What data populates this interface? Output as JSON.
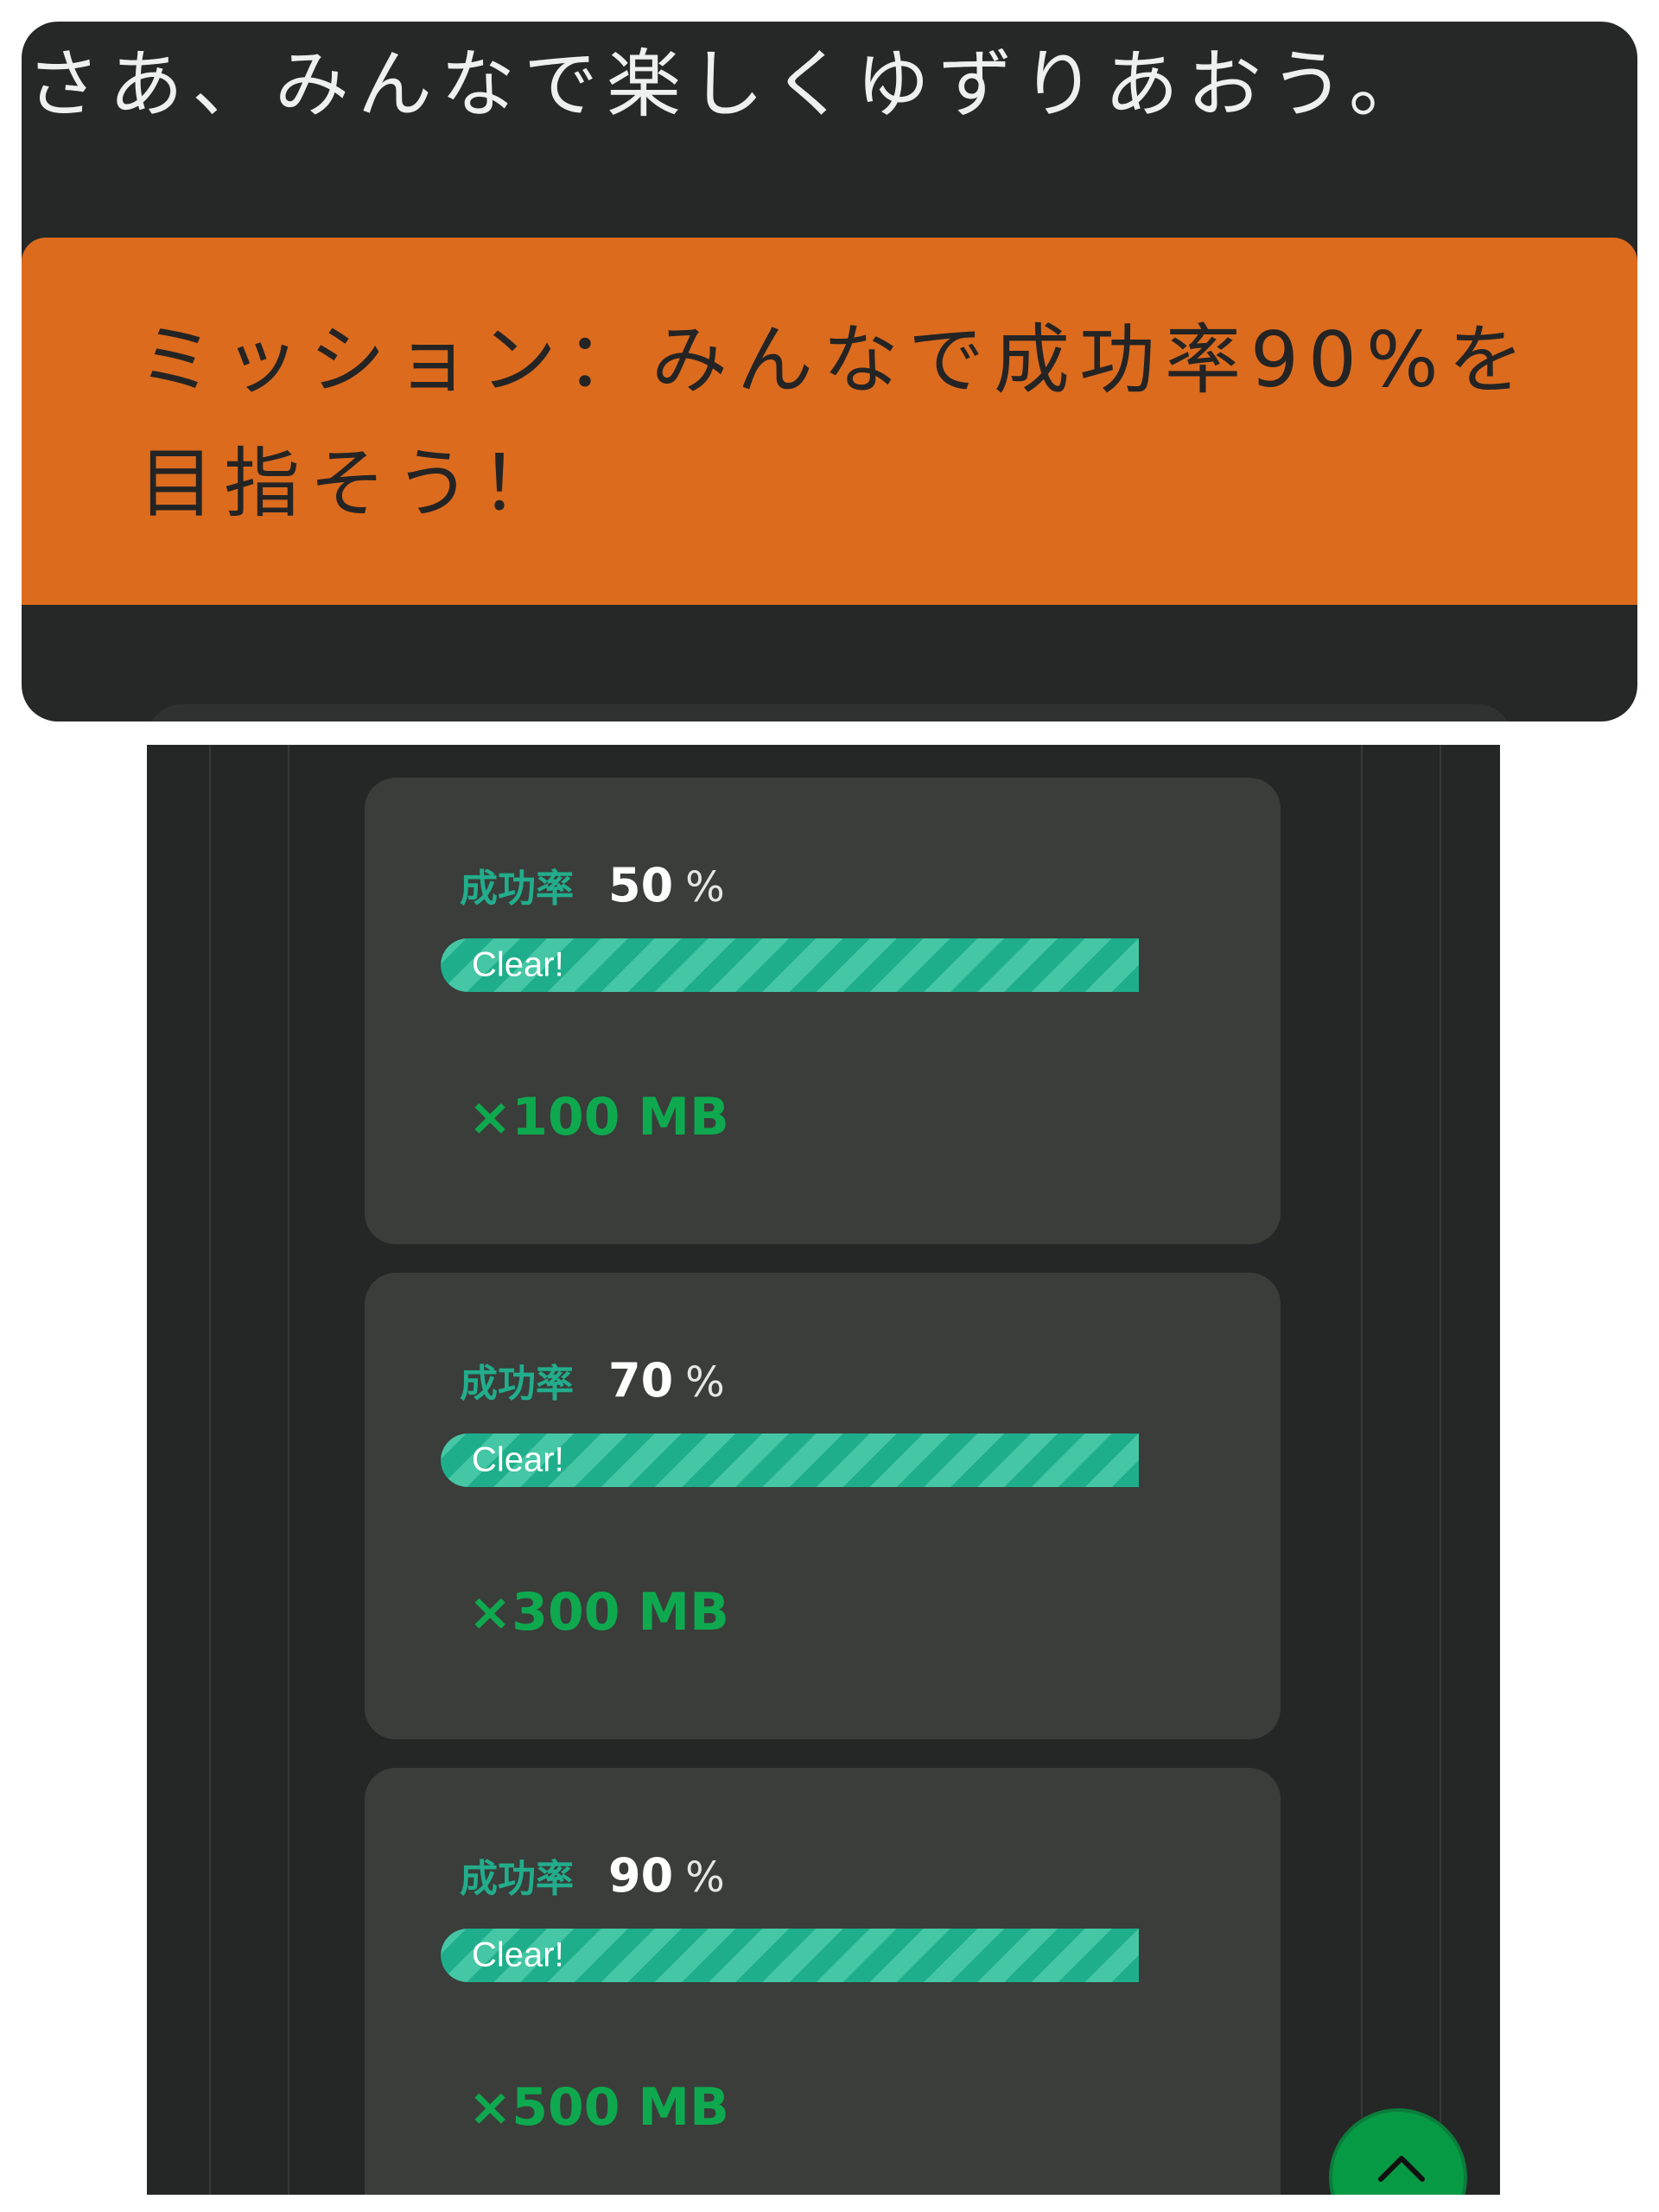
{
  "tagline": "さあ、みんなで楽しくゆずりあおう。",
  "mission": {
    "text": "ミッション：みんなで成功率90%を目指そう！"
  },
  "milestones": [
    {
      "rate_label": "成功率",
      "rate_value": "50",
      "rate_unit": "%",
      "status": "Clear!",
      "progress": 1.0,
      "reward": "×100 MB"
    },
    {
      "rate_label": "成功率",
      "rate_value": "70",
      "rate_unit": "%",
      "status": "Clear!",
      "progress": 1.0,
      "reward": "×300 MB"
    },
    {
      "rate_label": "成功率",
      "rate_value": "90",
      "rate_unit": "%",
      "status": "Clear!",
      "progress": 1.0,
      "reward": "×500 MB"
    }
  ],
  "scroll_top_icon": "chevron-up-icon",
  "colors": {
    "background": "#252827",
    "mission_banner": "#dc6b1e",
    "card": "#3a3d3a",
    "rate_label": "#22ad8c",
    "progress_fill": "#1fae8c",
    "reward": "#0ea94f",
    "scroll_button": "#079a45"
  }
}
